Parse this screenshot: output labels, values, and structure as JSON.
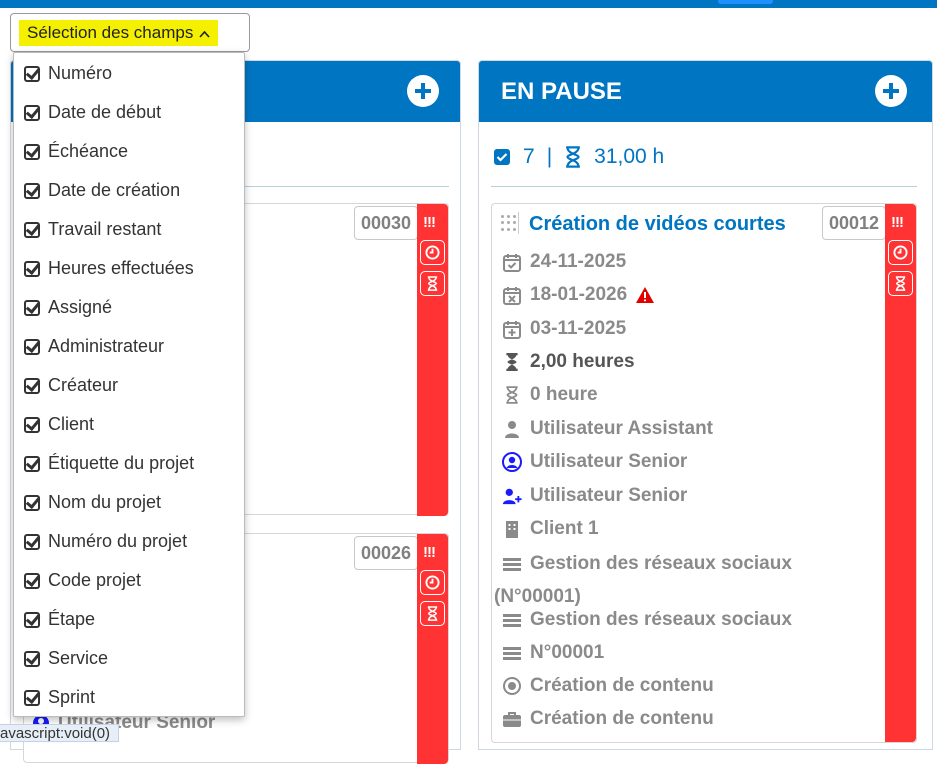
{
  "toolbar": {
    "field_selection_label": "Sélection des champs",
    "field_selection_icon": "chevron-up-icon"
  },
  "dropdown": {
    "options": [
      {
        "label": "Numéro",
        "checked": true
      },
      {
        "label": "Date de début",
        "checked": true
      },
      {
        "label": "Échéance",
        "checked": true
      },
      {
        "label": "Date de création",
        "checked": true
      },
      {
        "label": "Travail restant",
        "checked": true
      },
      {
        "label": "Heures effectuées",
        "checked": true
      },
      {
        "label": "Assigné",
        "checked": true
      },
      {
        "label": "Administrateur",
        "checked": true
      },
      {
        "label": "Créateur",
        "checked": true
      },
      {
        "label": "Client",
        "checked": true
      },
      {
        "label": "Étiquette du projet",
        "checked": true
      },
      {
        "label": "Nom du projet",
        "checked": true
      },
      {
        "label": "Numéro du projet",
        "checked": true
      },
      {
        "label": "Code projet",
        "checked": true
      },
      {
        "label": "Étape",
        "checked": true
      },
      {
        "label": "Service",
        "checked": true
      },
      {
        "label": "Sprint",
        "checked": true
      }
    ]
  },
  "left_column": {
    "cards": [
      {
        "number": "00030",
        "priority": "!!!"
      },
      {
        "number": "00026",
        "priority": "!!!"
      }
    ],
    "partial_text": "Utilisateur Senior"
  },
  "right_column": {
    "title": "EN PAUSE",
    "summary": {
      "count": "7",
      "separator": "|",
      "hours": "31,00 h"
    },
    "card": {
      "title": "Création de vidéos courtes",
      "number": "00012",
      "priority": "!!!",
      "start_date": "24-11-2025",
      "due_date": "18-01-2026",
      "created_date": "03-11-2025",
      "remaining": "2,00 heures",
      "done": "0 heure",
      "assignee": "Utilisateur Assistant",
      "admin": "Utilisateur Senior",
      "creator": "Utilisateur Senior",
      "client": "Client 1",
      "project_label": "Gestion des réseaux sociaux",
      "project_label_num": "(N°00001)",
      "project_name": "Gestion des réseaux sociaux",
      "project_number": "N°00001",
      "stage": "Création de contenu",
      "service": "Création de contenu"
    }
  },
  "statusbar": {
    "text": "avascript:void(0)"
  },
  "colors": {
    "primary": "#0075c2",
    "priority_red": "#ff3333",
    "highlight": "#f5f000",
    "admin_blue": "#1a1aff"
  }
}
